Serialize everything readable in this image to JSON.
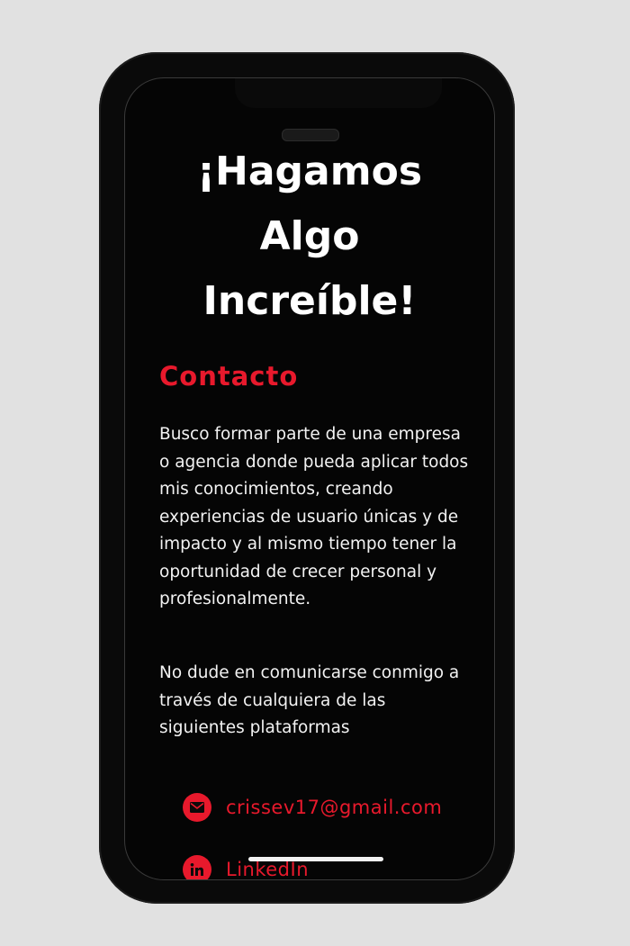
{
  "headline": {
    "line1": "¡Hagamos",
    "line2": "Algo",
    "line3": "Increíble!"
  },
  "contact": {
    "title": "Contacto",
    "paragraph1": "Busco formar parte de una empresa o agencia donde pueda aplicar todos mis conocimientos, creando experiencias de usuario únicas y de impacto y al mismo tiempo tener la oportunidad de crecer personal y profesionalmente.",
    "paragraph2": "No dude en comunicarse conmigo a través de cualquiera de las siguientes plataformas",
    "links": [
      {
        "icon": "email-icon",
        "label": "crissev17@gmail.com"
      },
      {
        "icon": "linkedin-icon",
        "label": "LinkedIn"
      }
    ]
  },
  "colors": {
    "accent": "#e8192c",
    "background": "#050505",
    "text": "#f2f2f2"
  }
}
